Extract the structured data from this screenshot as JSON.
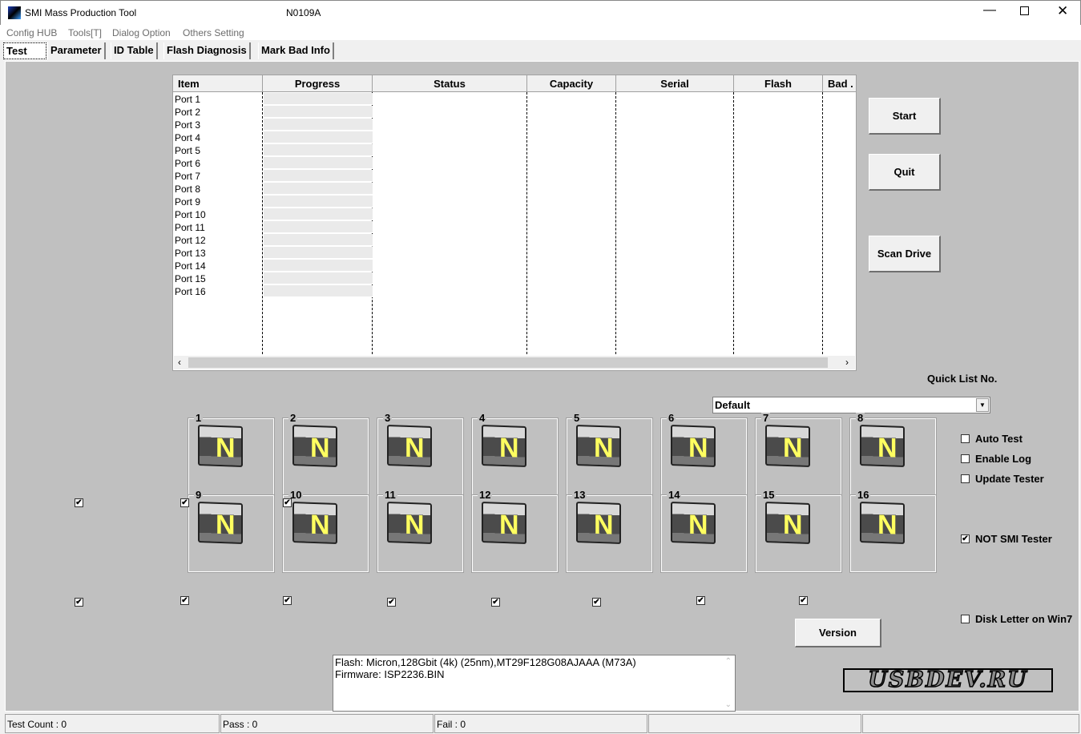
{
  "window": {
    "title": "SMI Mass Production Tool",
    "version": "N0109A"
  },
  "menu": [
    "Config HUB",
    "Tools[T]",
    "Dialog Option",
    "Others Setting"
  ],
  "tabs": [
    "Test",
    "Parameter",
    "ID Table",
    "Flash Diagnosis",
    "Mark Bad Info"
  ],
  "table": {
    "columns": [
      "Item",
      "Progress",
      "Status",
      "Capacity",
      "Serial",
      "Flash",
      "Bad ."
    ],
    "rows": [
      "Port 1",
      "Port 2",
      "Port 3",
      "Port 4",
      "Port 5",
      "Port 6",
      "Port 7",
      "Port 8",
      "Port 9",
      "Port 10",
      "Port 11",
      "Port 12",
      "Port 13",
      "Port 14",
      "Port 15",
      "Port 16"
    ]
  },
  "buttons": {
    "start": "Start",
    "quit": "Quit",
    "scan": "Scan Drive",
    "version": "Version"
  },
  "quick_list": {
    "label": "Quick List No.",
    "value": "Default"
  },
  "options": [
    {
      "label": "Auto Test",
      "checked": false
    },
    {
      "label": "Enable Log",
      "checked": false
    },
    {
      "label": "Update Tester",
      "checked": false
    },
    {
      "label": "NOT SMI Tester",
      "checked": true
    },
    {
      "label": "Disk Letter on Win7",
      "checked": false
    }
  ],
  "ports": [
    "1",
    "2",
    "3",
    "4",
    "5",
    "6",
    "7",
    "8",
    "9",
    "10",
    "11",
    "12",
    "13",
    "14",
    "15",
    "16"
  ],
  "port_icon_letter": "N",
  "info": {
    "line1": "Flash: Micron,128Gbit (4k) (25nm),MT29F128G08AJAAA (M73A)",
    "line2": "Firmware: ISP2236.BIN"
  },
  "logo": "USBDEV.RU",
  "status": {
    "test_count": "Test Count : 0",
    "pass": "Pass : 0",
    "fail": "Fail : 0"
  }
}
